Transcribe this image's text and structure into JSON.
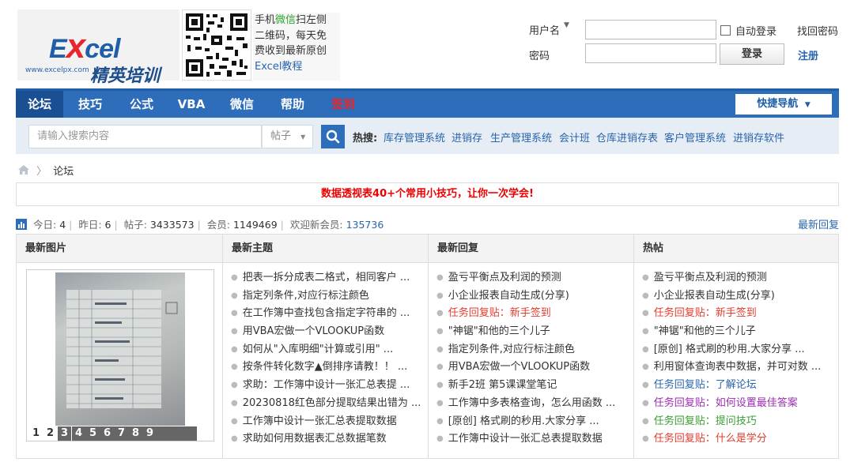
{
  "logo": {
    "big_text": "Excel",
    "sub_text": "精英培训",
    "url": "www.excelpx.com"
  },
  "qr_caption": {
    "line1_pre": "手机",
    "line1_wx": "微信",
    "line1_post": "扫左侧",
    "line2": "二维码，每天免",
    "line3": "费收到最新原创",
    "line4": "Excel教程"
  },
  "login": {
    "user_label": "用户名",
    "pass_label": "密码",
    "auto_login": "自动登录",
    "find_password": "找回密码",
    "login_button": "登录",
    "register": "注册"
  },
  "nav": {
    "items": [
      "论坛",
      "技巧",
      "公式",
      "VBA",
      "微信",
      "帮助",
      "签到"
    ],
    "quick_nav": "快捷导航"
  },
  "search": {
    "placeholder": "请输入搜索内容",
    "type": "帖子",
    "hot_label": "热搜:",
    "hot_words": [
      "库存管理系统",
      "进销存",
      "生产管理系统",
      "会计班",
      "仓库进销存表",
      "客户管理系统",
      "进销存软件"
    ]
  },
  "breadcrumb": {
    "current": "论坛"
  },
  "announcement": "数据透视表40+个常用小技巧，让你一次学会!",
  "stats": {
    "today_label": "今日:",
    "today": "4",
    "yesterday_label": "昨日:",
    "yesterday": "6",
    "posts_label": "帖子:",
    "posts": "3433573",
    "members_label": "会员:",
    "members": "1149469",
    "welcome_label": "欢迎新会员:",
    "welcome": "135736",
    "latest_reply": "最新回复"
  },
  "panels": {
    "images": {
      "title": "最新图片",
      "pages": [
        "1",
        "2",
        "3",
        "4",
        "5",
        "6",
        "7",
        "8",
        "9"
      ]
    },
    "new_topics": {
      "title": "最新主题",
      "items": [
        "把表一拆分成表二格式，相同客户 ...",
        "指定列条件,对应行标注颜色",
        "在工作簿中查找包含指定字符串的 ...",
        "用VBA宏做一个VLOOKUP函数",
        "如何从\"入库明细\"计算或引用\" ...",
        "按条件转化数字▲倒排序请教！！ ...",
        "求助：工作簿中设计一张汇总表提 ...",
        "20230818红色部分提取结果出错为 ...",
        "工作簿中设计一张汇总表提取数据",
        "求助如何用数据表汇总数据笔数"
      ]
    },
    "new_replies": {
      "title": "最新回复",
      "items": [
        "盈亏平衡点及利润的预测",
        "小企业报表自动生成(分享)",
        "任务回复贴：新手签到",
        "\"神锯\"和他的三个儿子",
        "指定列条件,对应行标注颜色",
        "用VBA宏做一个VLOOKUP函数",
        "新手2班 第5课课堂笔记",
        "工作簿中多表格查询，怎么用函数 ...",
        "[原创] 格式刷的秒用.大家分享 ...",
        "工作簿中设计一张汇总表提取数据"
      ]
    },
    "hot": {
      "title": "热帖",
      "items": [
        "盈亏平衡点及利润的预测",
        "小企业报表自动生成(分享)",
        "任务回复贴：新手签到",
        "\"神锯\"和他的三个儿子",
        "[原创] 格式刷的秒用.大家分享 ...",
        "利用窗体查询表中数据，并可对数 ...",
        "任务回复贴：了解论坛",
        "任务回复贴：如何设置最佳答案",
        "任务回复贴：提问技巧",
        "任务回复贴：什么是学分"
      ]
    }
  }
}
